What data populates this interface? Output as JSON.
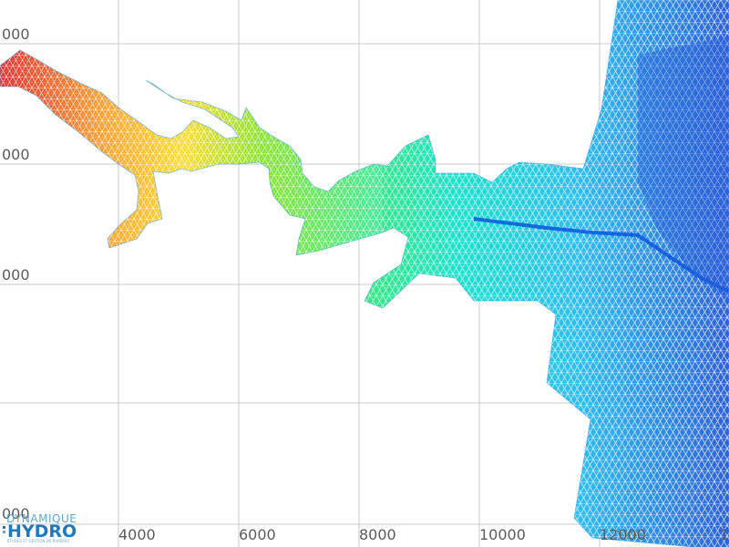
{
  "x_ticks": [
    "4000",
    "6000",
    "8000",
    "10000",
    "12000",
    "1"
  ],
  "y_ticks": [
    "000",
    "000",
    "000",
    "000"
  ],
  "logo": {
    "line1": "DYNAMIQUE",
    "line2": "HYDRO",
    "line3": "ÉTUDES ET GESTION DE RIVIÈRES"
  },
  "colors": {
    "grid": "#c8c8c8",
    "mesh_scale": [
      "#e50000",
      "#ffcc00",
      "#55e000",
      "#00e8b8",
      "#00a8ff",
      "#0040d8"
    ]
  },
  "mesh": {
    "description_type": "triangular finite-element mesh colored by depth/elevation",
    "scale_low_color": "red",
    "scale_high_color": "blue"
  }
}
